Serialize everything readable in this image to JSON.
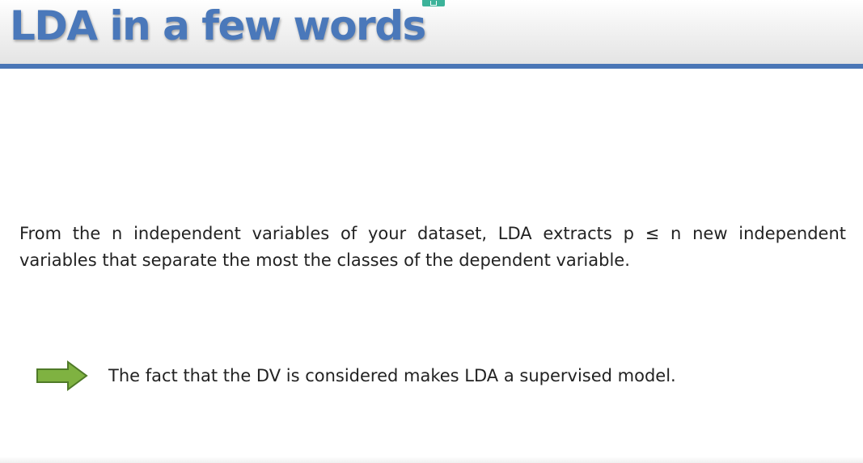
{
  "slide": {
    "title": "LDA in a few words",
    "paragraph": "From the n independent variables of your dataset, LDA extracts p ≤ n new independent variables that separate the most the classes of the dependent variable.",
    "point": {
      "icon": "right-arrow-icon",
      "text": "The fact that the DV is considered makes LDA a supervised model."
    }
  },
  "colors": {
    "title": "#4a78ba",
    "header_rule": "#4a76b6",
    "arrow_fill": "#7fb241",
    "arrow_stroke": "#4f7a28",
    "body_text": "#222222"
  }
}
